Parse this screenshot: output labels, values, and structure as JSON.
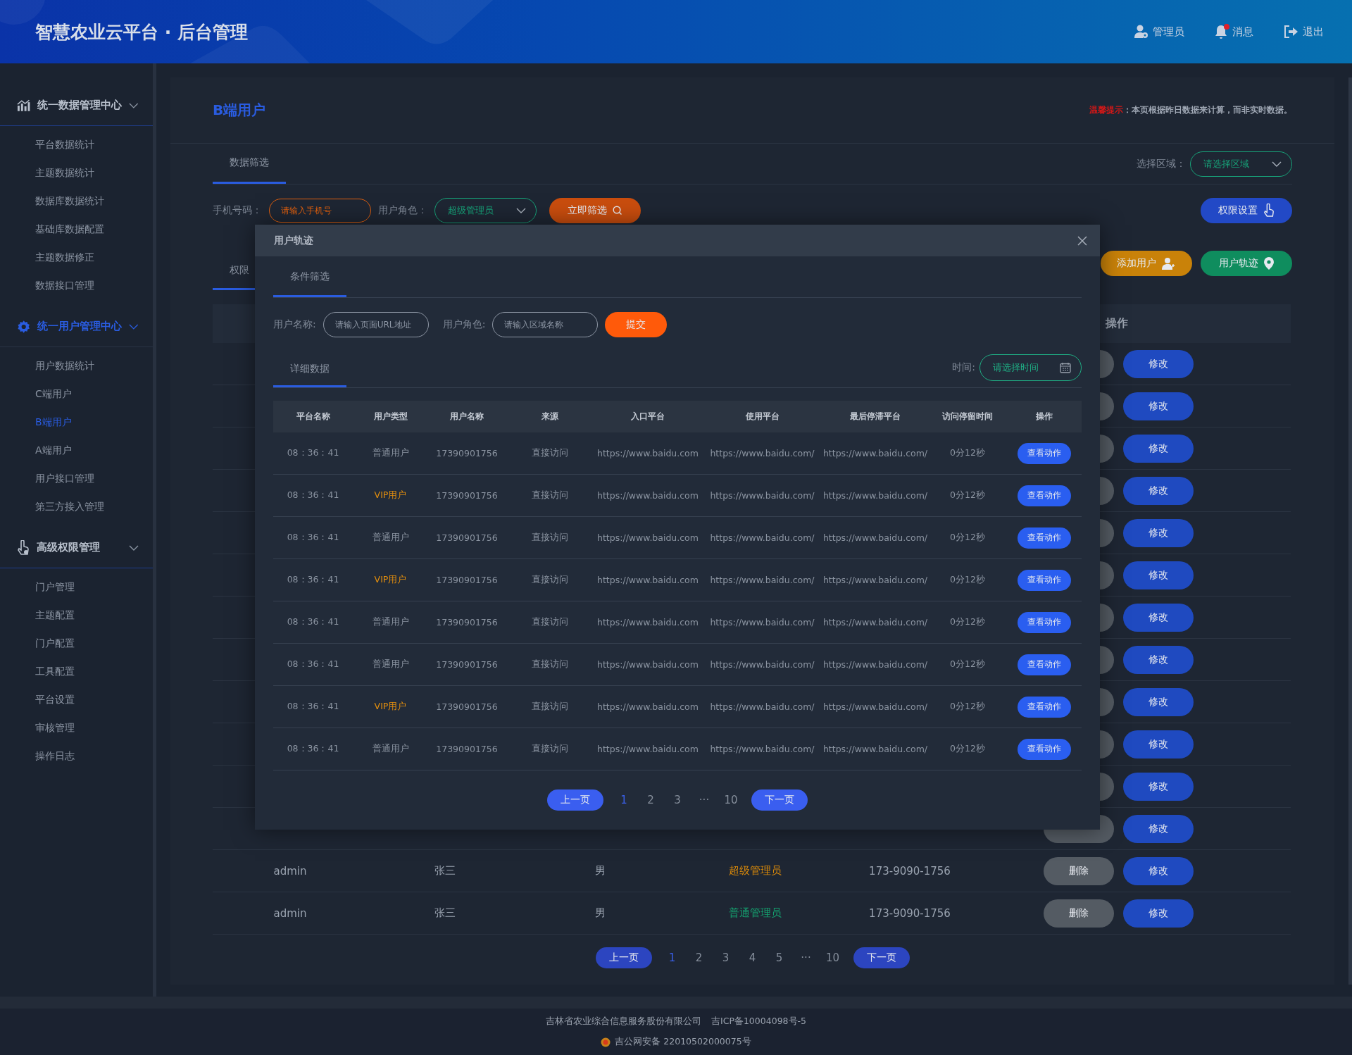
{
  "header": {
    "title": "智慧农业云平台 · 后台管理",
    "actions": [
      {
        "kind": "admin",
        "label": "管理员"
      },
      {
        "kind": "message",
        "label": "消息",
        "unread": true
      },
      {
        "kind": "logout",
        "label": "退出"
      }
    ]
  },
  "sidebar": {
    "groups": [
      {
        "kind": "chart",
        "title": "统一数据管理中心",
        "selected": false,
        "expanded": true,
        "items": [
          {
            "label": "平台数据统计",
            "selected": false
          },
          {
            "label": "主题数据统计",
            "selected": false
          },
          {
            "label": "数据库数据统计",
            "selected": false
          },
          {
            "label": "基础库数据配置",
            "selected": false
          },
          {
            "label": "主题数据修正",
            "selected": false
          },
          {
            "label": "数据接口管理",
            "selected": false
          }
        ]
      },
      {
        "kind": "gear",
        "title": "统一用户管理中心",
        "selected": true,
        "expanded": true,
        "items": [
          {
            "label": "用户数据统计",
            "selected": false
          },
          {
            "label": "C端用户",
            "selected": false
          },
          {
            "label": "B端用户",
            "selected": true
          },
          {
            "label": "A端用户",
            "selected": false
          },
          {
            "label": "用户接口管理",
            "selected": false
          },
          {
            "label": "第三方接入管理",
            "selected": false
          }
        ]
      },
      {
        "kind": "hand",
        "title": "高级权限管理",
        "selected": false,
        "expanded": true,
        "items": [
          {
            "label": "门户管理",
            "selected": false
          },
          {
            "label": "主题配置",
            "selected": false
          },
          {
            "label": "门户配置",
            "selected": false
          },
          {
            "label": "工具配置",
            "selected": false
          },
          {
            "label": "平台设置",
            "selected": false
          },
          {
            "label": "审核管理",
            "selected": false
          },
          {
            "label": "操作日志",
            "selected": false
          }
        ]
      }
    ]
  },
  "page": {
    "title": "B端用户",
    "notice_label": "温馨提示",
    "notice_text": "：本页根据昨日数据来计算，而非实时数据。",
    "filter_tab": {
      "label": "数据筛选",
      "selected": true
    },
    "region": {
      "label": "选择区域：",
      "placeholder": "请选择区域"
    },
    "phone": {
      "label": "手机号码：",
      "placeholder": "请输入手机号"
    },
    "role": {
      "label": "用户角色：",
      "value": "超级管理员"
    },
    "filter_button": "立即筛选",
    "permission_button": "权限设置",
    "list_tab": {
      "label": "权限",
      "selected": true
    },
    "add_button": "添加用户",
    "track_button": "用户轨迹",
    "table": {
      "columns": [
        "操作"
      ],
      "rows": [
        {
          "edit": "修改"
        },
        {
          "edit": "修改"
        },
        {
          "edit": "修改"
        },
        {
          "edit": "修改"
        },
        {
          "edit": "修改"
        },
        {
          "edit": "修改"
        },
        {
          "edit": "修改"
        },
        {
          "edit": "修改"
        },
        {
          "edit": "修改"
        },
        {
          "edit": "修改"
        },
        {
          "edit": "修改"
        },
        {
          "edit": "修改"
        },
        {
          "account": "admin",
          "name": "张三",
          "gender": "男",
          "role": "超级管理员",
          "color": "#d9890a",
          "phone": "173-9090-1756",
          "delete": "删除",
          "edit": "修改"
        },
        {
          "account": "admin",
          "name": "张三",
          "gender": "男",
          "role": "普通管理员",
          "color": "#15a06f",
          "phone": "173-9090-1756",
          "delete": "删除",
          "edit": "修改"
        }
      ]
    },
    "pagination": {
      "prev": "上一页",
      "next": "下一页",
      "pages": [
        {
          "label": "1",
          "selected": true
        },
        {
          "label": "2",
          "selected": false
        },
        {
          "label": "3",
          "selected": false
        },
        {
          "label": "4",
          "selected": false
        },
        {
          "label": "5",
          "selected": false
        },
        {
          "label": "···",
          "selected": false
        },
        {
          "label": "10",
          "selected": false
        }
      ]
    }
  },
  "modal": {
    "title": "用户轨迹",
    "filter_tab": {
      "label": "条件筛选",
      "selected": true
    },
    "username": {
      "label": "用户名称:",
      "placeholder": "请输入页面URL地址"
    },
    "role": {
      "label": "用户角色:",
      "placeholder": "请输入区域名称"
    },
    "submit": "提交",
    "detail_tab": {
      "label": "详细数据",
      "selected": true
    },
    "time": {
      "label": "时间:",
      "placeholder": "请选择时间"
    },
    "table": {
      "columns": [
        "平台名称",
        "用户类型",
        "用户名称",
        "来源",
        "入口平台",
        "使用平台",
        "最后停滞平台",
        "访问停留时间",
        "操作"
      ],
      "rows": [
        {
          "time": "08：36：41",
          "type": "普通用户",
          "color": "#8b94a1",
          "user": "17390901756",
          "source": "直接访问",
          "entry": "https://www.baidu.com",
          "use": "https://www.baidu.com/",
          "last": "https://www.baidu.com/",
          "stay": "0分12秒",
          "action": "查看动作"
        },
        {
          "time": "08：36：41",
          "type": "VIP用户",
          "color": "#e48f0d",
          "user": "17390901756",
          "source": "直接访问",
          "entry": "https://www.baidu.com",
          "use": "https://www.baidu.com/",
          "last": "https://www.baidu.com/",
          "stay": "0分12秒",
          "action": "查看动作"
        },
        {
          "time": "08：36：41",
          "type": "普通用户",
          "color": "#8b94a1",
          "user": "17390901756",
          "source": "直接访问",
          "entry": "https://www.baidu.com",
          "use": "https://www.baidu.com/",
          "last": "https://www.baidu.com/",
          "stay": "0分12秒",
          "action": "查看动作"
        },
        {
          "time": "08：36：41",
          "type": "VIP用户",
          "color": "#e48f0d",
          "user": "17390901756",
          "source": "直接访问",
          "entry": "https://www.baidu.com",
          "use": "https://www.baidu.com/",
          "last": "https://www.baidu.com/",
          "stay": "0分12秒",
          "action": "查看动作"
        },
        {
          "time": "08：36：41",
          "type": "普通用户",
          "color": "#8b94a1",
          "user": "17390901756",
          "source": "直接访问",
          "entry": "https://www.baidu.com",
          "use": "https://www.baidu.com/",
          "last": "https://www.baidu.com/",
          "stay": "0分12秒",
          "action": "查看动作"
        },
        {
          "time": "08：36：41",
          "type": "普通用户",
          "color": "#8b94a1",
          "user": "17390901756",
          "source": "直接访问",
          "entry": "https://www.baidu.com",
          "use": "https://www.baidu.com/",
          "last": "https://www.baidu.com/",
          "stay": "0分12秒",
          "action": "查看动作"
        },
        {
          "time": "08：36：41",
          "type": "VIP用户",
          "color": "#e48f0d",
          "user": "17390901756",
          "source": "直接访问",
          "entry": "https://www.baidu.com",
          "use": "https://www.baidu.com/",
          "last": "https://www.baidu.com/",
          "stay": "0分12秒",
          "action": "查看动作"
        },
        {
          "time": "08：36：41",
          "type": "普通用户",
          "color": "#8b94a1",
          "user": "17390901756",
          "source": "直接访问",
          "entry": "https://www.baidu.com",
          "use": "https://www.baidu.com/",
          "last": "https://www.baidu.com/",
          "stay": "0分12秒",
          "action": "查看动作"
        }
      ]
    },
    "pagination": {
      "prev": "上一页",
      "next": "下一页",
      "pages": [
        {
          "label": "1",
          "selected": true
        },
        {
          "label": "2",
          "selected": false
        },
        {
          "label": "3",
          "selected": false
        },
        {
          "label": "···",
          "selected": false
        },
        {
          "label": "10",
          "selected": false
        }
      ]
    }
  },
  "footer": {
    "company": "吉林省农业综合信息服务股份有限公司",
    "icp": "吉ICP备10004098号-5",
    "police": "吉公网安备 22010502000075号"
  }
}
